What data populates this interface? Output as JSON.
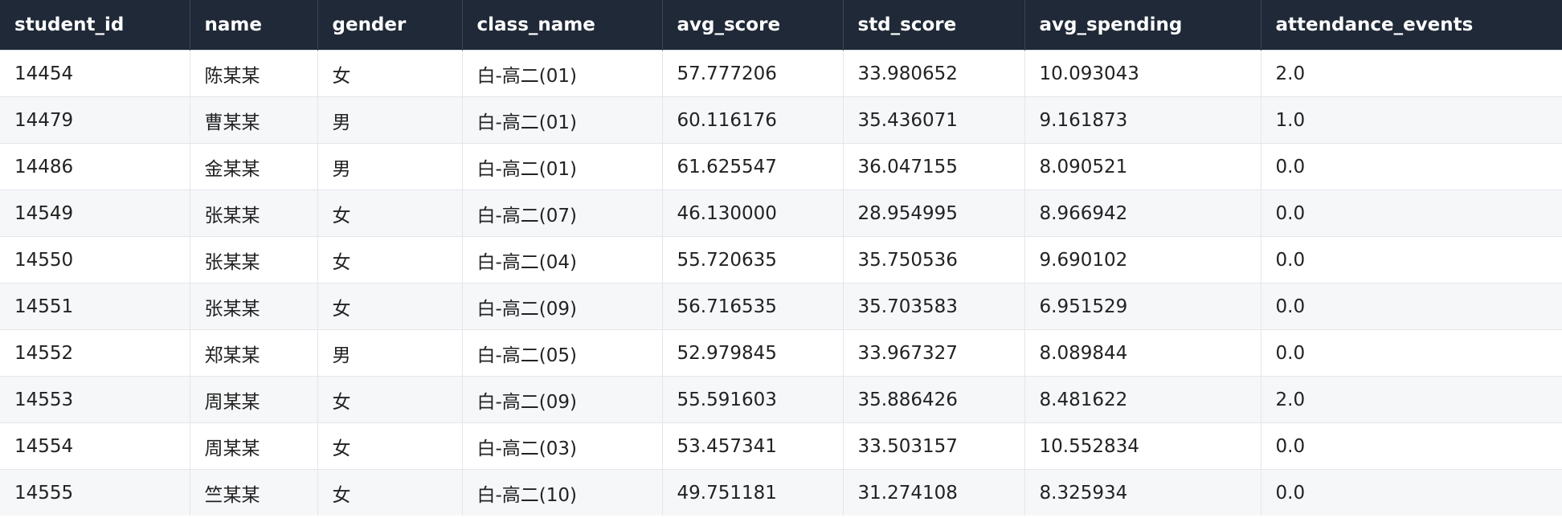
{
  "table": {
    "columns": [
      "student_id",
      "name",
      "gender",
      "class_name",
      "avg_score",
      "std_score",
      "avg_spending",
      "attendance_events"
    ],
    "rows": [
      [
        "14454",
        "陈某某",
        "女",
        "白-高二(01)",
        "57.777206",
        "33.980652",
        "10.093043",
        "2.0"
      ],
      [
        "14479",
        "曹某某",
        "男",
        "白-高二(01)",
        "60.116176",
        "35.436071",
        "9.161873",
        "1.0"
      ],
      [
        "14486",
        "金某某",
        "男",
        "白-高二(01)",
        "61.625547",
        "36.047155",
        "8.090521",
        "0.0"
      ],
      [
        "14549",
        "张某某",
        "女",
        "白-高二(07)",
        "46.130000",
        "28.954995",
        "8.966942",
        "0.0"
      ],
      [
        "14550",
        "张某某",
        "女",
        "白-高二(04)",
        "55.720635",
        "35.750536",
        "9.690102",
        "0.0"
      ],
      [
        "14551",
        "张某某",
        "女",
        "白-高二(09)",
        "56.716535",
        "35.703583",
        "6.951529",
        "0.0"
      ],
      [
        "14552",
        "郑某某",
        "男",
        "白-高二(05)",
        "52.979845",
        "33.967327",
        "8.089844",
        "0.0"
      ],
      [
        "14553",
        "周某某",
        "女",
        "白-高二(09)",
        "55.591603",
        "35.886426",
        "8.481622",
        "2.0"
      ],
      [
        "14554",
        "周某某",
        "女",
        "白-高二(03)",
        "53.457341",
        "33.503157",
        "10.552834",
        "0.0"
      ],
      [
        "14555",
        "竺某某",
        "女",
        "白-高二(10)",
        "49.751181",
        "31.274108",
        "8.325934",
        "0.0"
      ]
    ]
  },
  "colors": {
    "header_bg": "#1f2937",
    "header_text": "#ffffff",
    "row_alt_bg": "#f6f7f9",
    "border": "#e3e6ea"
  }
}
